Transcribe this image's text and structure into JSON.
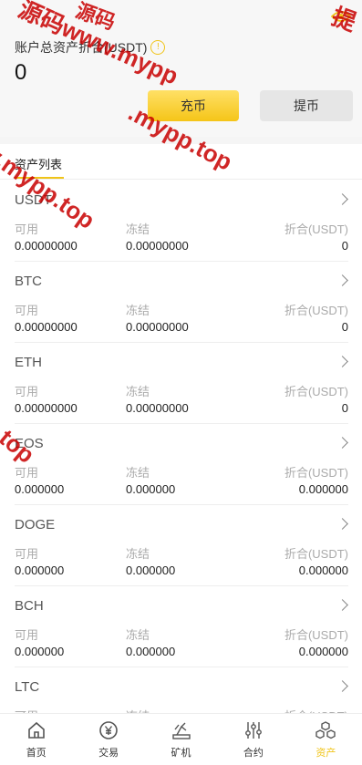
{
  "header": {
    "total_label": "账户总资产折合(USDT)",
    "total_value": "0",
    "deposit_label": "充币",
    "withdraw_label": "提币"
  },
  "tabs": {
    "assets_label": "资产列表"
  },
  "assets": [
    {
      "coin": "USDT",
      "available_label": "可用",
      "frozen_label": "冻结",
      "converted_label": "折合(USDT)",
      "available": "0.00000000",
      "frozen": "0.00000000",
      "converted": "0"
    },
    {
      "coin": "BTC",
      "available_label": "可用",
      "frozen_label": "冻结",
      "converted_label": "折合(USDT)",
      "available": "0.00000000",
      "frozen": "0.00000000",
      "converted": "0"
    },
    {
      "coin": "ETH",
      "available_label": "可用",
      "frozen_label": "冻结",
      "converted_label": "折合(USDT)",
      "available": "0.00000000",
      "frozen": "0.00000000",
      "converted": "0"
    },
    {
      "coin": "EOS",
      "available_label": "可用",
      "frozen_label": "冻结",
      "converted_label": "折合(USDT)",
      "available": "0.000000",
      "frozen": "0.000000",
      "converted": "0.000000"
    },
    {
      "coin": "DOGE",
      "available_label": "可用",
      "frozen_label": "冻结",
      "converted_label": "折合(USDT)",
      "available": "0.000000",
      "frozen": "0.000000",
      "converted": "0.000000"
    },
    {
      "coin": "BCH",
      "available_label": "可用",
      "frozen_label": "冻结",
      "converted_label": "折合(USDT)",
      "available": "0.000000",
      "frozen": "0.000000",
      "converted": "0.000000"
    },
    {
      "coin": "LTC",
      "available_label": "可用",
      "frozen_label": "冻结",
      "converted_label": "折合(USDT)",
      "available": "",
      "frozen": "",
      "converted": ""
    }
  ],
  "nav": [
    {
      "label": "首页",
      "icon": "home-icon"
    },
    {
      "label": "交易",
      "icon": "yuan-icon"
    },
    {
      "label": "矿机",
      "icon": "mining-icon"
    },
    {
      "label": "合约",
      "icon": "sliders-icon"
    },
    {
      "label": "资产",
      "icon": "cubes-icon"
    }
  ],
  "watermark": {
    "text1": "源码www.mypp",
    "text2": ".mypp.top",
    "text3": "w.mypp.top",
    "text4": "p.top",
    "text5": "提",
    "text6": "源码"
  },
  "colors": {
    "accent": "#f0c419",
    "watermark": "#c80000"
  }
}
